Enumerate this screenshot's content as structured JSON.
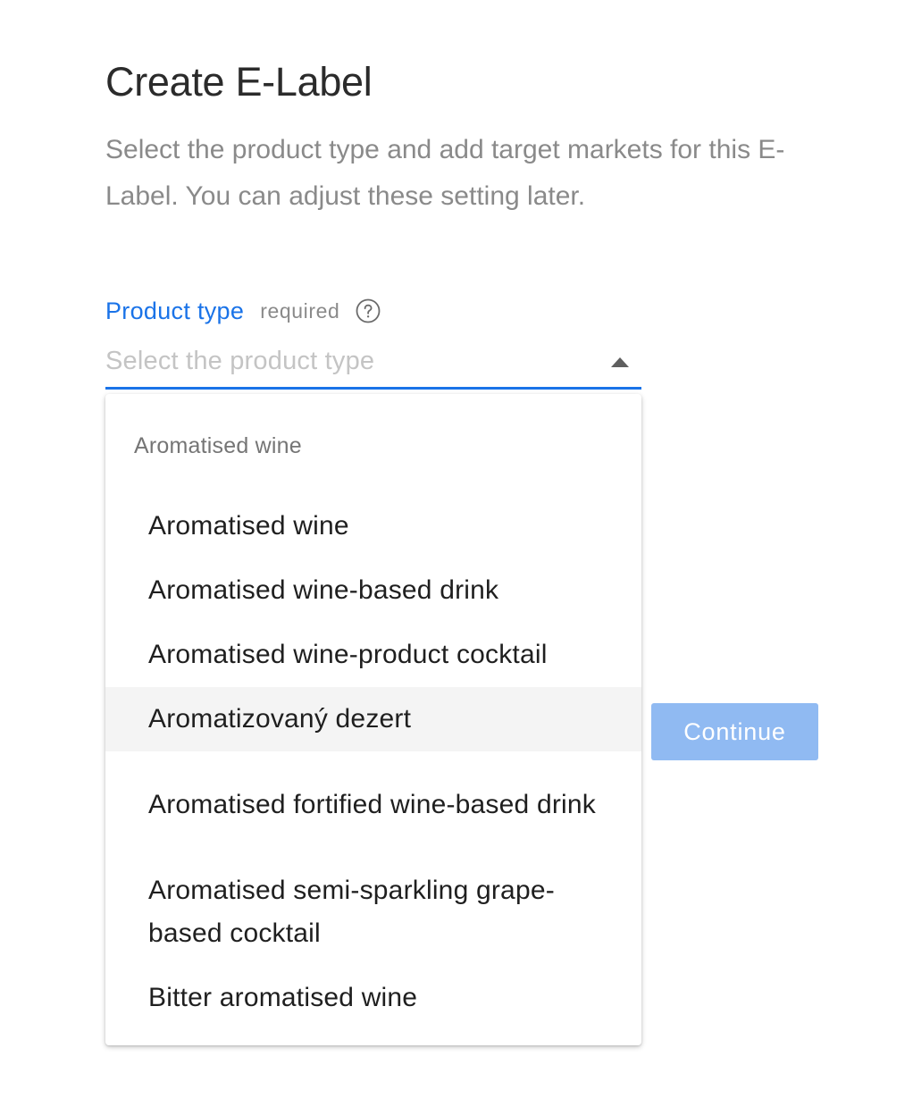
{
  "page": {
    "title": "Create E-Label",
    "description": "Select the product type and add target markets for this E-Label. You can adjust these setting later."
  },
  "form": {
    "product_type": {
      "label": "Product type",
      "required_text": "required",
      "help_icon": "question-circle-icon",
      "placeholder": "Select the product type",
      "accent_color": "#1a73e8",
      "dropdown_open": true
    }
  },
  "dropdown": {
    "group_header": "Aromatised wine",
    "options": [
      {
        "label": "Aromatised wine"
      },
      {
        "label": "Aromatised wine-based drink"
      },
      {
        "label": "Aromatised wine-product cocktail"
      },
      {
        "label": "Aromatizovaný dezert",
        "hovered": true
      },
      {
        "label": "Aromatised fortified wine-based drink"
      },
      {
        "label": "Aromatised semi-sparkling grape-based cocktail"
      },
      {
        "label": "Bitter aromatised wine"
      }
    ]
  },
  "actions": {
    "continue_label": "Continue",
    "continue_color": "#90baf2",
    "continue_disabled": true
  }
}
